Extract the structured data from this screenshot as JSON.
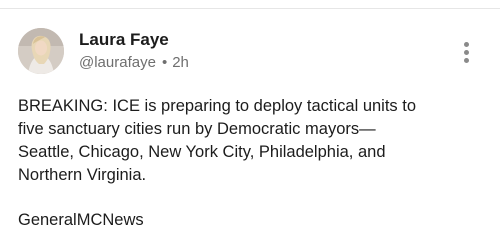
{
  "post": {
    "author_name": "Laura Faye",
    "handle": "@laurafaye",
    "separator": "•",
    "timestamp": "2h",
    "avatar_icon": "user-photo",
    "more_icon": "vertical-ellipsis-icon",
    "lines": [
      "BREAKING: ICE is preparing to deploy tactical units to",
      "five sanctuary cities run by Democratic mayors—",
      "Seattle, Chicago, New York City, Philadelphia, and",
      "Northern Virginia."
    ],
    "source": "GeneralMCNews"
  }
}
